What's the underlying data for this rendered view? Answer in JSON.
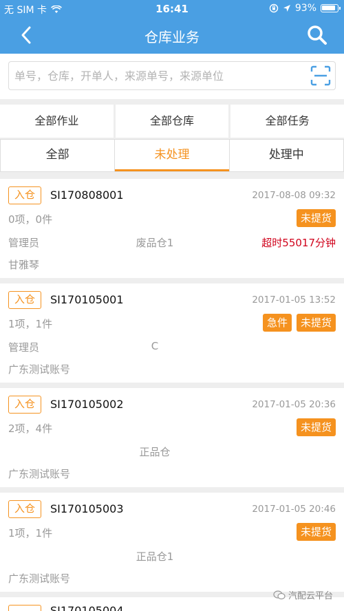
{
  "status_bar": {
    "carrier": "无 SIM 卡",
    "time": "16:41",
    "battery": "93%"
  },
  "header": {
    "title": "仓库业务",
    "back_icon": "chevron-left-icon",
    "search_icon": "search-icon"
  },
  "search": {
    "placeholder": "单号，仓库，开单人，来源单号，来源单位",
    "value": "",
    "scan_icon": "scan-icon"
  },
  "filters": [
    {
      "label": "全部作业"
    },
    {
      "label": "全部仓库"
    },
    {
      "label": "全部任务"
    }
  ],
  "tabs": [
    {
      "label": "全部"
    },
    {
      "label": "未处理",
      "active": true
    },
    {
      "label": "处理中"
    }
  ],
  "colors": {
    "header_bg": "#4a9fe3",
    "accent": "#f5921f",
    "danger": "#d0021b"
  },
  "orders": [
    {
      "type": "入仓",
      "code": "SI170808001",
      "date": "2017-08-08 09:32",
      "qty": "0项，0件",
      "tags": [
        "未提货"
      ],
      "manager": "管理员",
      "warehouse": "废品仓1",
      "overdue": "超时55017分钟",
      "person": "甘雅琴"
    },
    {
      "type": "入仓",
      "code": "SI170105001",
      "date": "2017-01-05 13:52",
      "qty": "1项，1件",
      "tags": [
        "急件",
        "未提货"
      ],
      "manager": "管理员",
      "warehouse": "C",
      "overdue": "",
      "person": "广东测试账号"
    },
    {
      "type": "入仓",
      "code": "SI170105002",
      "date": "2017-01-05 20:36",
      "qty": "2项，4件",
      "tags": [
        "未提货"
      ],
      "manager": "",
      "warehouse": "正品仓",
      "overdue": "",
      "person": "广东测试账号"
    },
    {
      "type": "入仓",
      "code": "SI170105003",
      "date": "2017-01-05 20:46",
      "qty": "1项，1件",
      "tags": [
        "未提货"
      ],
      "manager": "",
      "warehouse": "正品仓1",
      "overdue": "",
      "person": "广东测试账号"
    }
  ],
  "partial_order": {
    "code": "SI170105004"
  },
  "watermark": {
    "text": "汽配云平台"
  }
}
